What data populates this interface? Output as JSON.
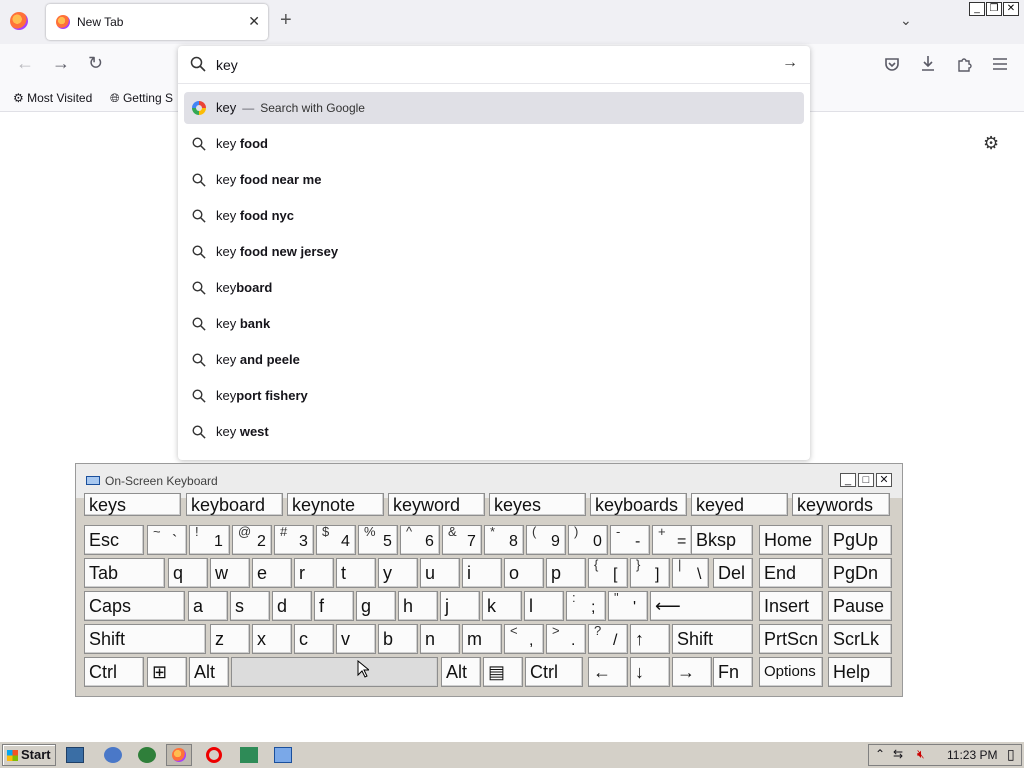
{
  "browser": {
    "tab_title": "New Tab",
    "tab_close": "✕",
    "new_tab_glyph": "+",
    "list_tabs_glyph": "⌄",
    "nav": {
      "back": "←",
      "forward": "→",
      "reload": "↻"
    },
    "bookmarks": [
      {
        "label": "Most Visited",
        "icon": "gear-icon"
      },
      {
        "label": "Getting S",
        "icon": "globe-icon"
      }
    ],
    "window_controls": {
      "minimize": "_",
      "restore": "❐",
      "close": "✕"
    }
  },
  "urlbar": {
    "value": "key",
    "go_glyph": "→",
    "suggestions": [
      {
        "prefix": "key",
        "bold": "",
        "hint": "Search with Google",
        "selected": true,
        "icon": "google-icon"
      },
      {
        "prefix": "key ",
        "bold": "food",
        "icon": "search-icon"
      },
      {
        "prefix": "key ",
        "bold": "food near me",
        "icon": "search-icon"
      },
      {
        "prefix": "key ",
        "bold": "food nyc",
        "icon": "search-icon"
      },
      {
        "prefix": "key ",
        "bold": "food new jersey",
        "icon": "search-icon"
      },
      {
        "prefix": "key",
        "bold": "board",
        "icon": "search-icon"
      },
      {
        "prefix": "key ",
        "bold": "bank",
        "icon": "search-icon"
      },
      {
        "prefix": "key ",
        "bold": "and peele",
        "icon": "search-icon"
      },
      {
        "prefix": "key",
        "bold": "port fishery",
        "icon": "search-icon"
      },
      {
        "prefix": "key ",
        "bold": "west",
        "icon": "search-icon"
      }
    ],
    "separator": "—"
  },
  "osk": {
    "title": "On-Screen Keyboard",
    "controls": {
      "minimize": "_",
      "maximize": "□",
      "close": "✕"
    },
    "predictions": [
      "keys",
      "keyboard",
      "keynote",
      "keyword",
      "keyes",
      "keyboards",
      "keyed",
      "keywords"
    ],
    "rows": [
      [
        {
          "main": "Esc"
        },
        {
          "up": "~",
          "dn": "`"
        },
        {
          "up": "!",
          "dn": "1"
        },
        {
          "up": "@",
          "dn": "2"
        },
        {
          "up": "#",
          "dn": "3"
        },
        {
          "up": "$",
          "dn": "4"
        },
        {
          "up": "%",
          "dn": "5"
        },
        {
          "up": "^",
          "dn": "6"
        },
        {
          "up": "&",
          "dn": "7"
        },
        {
          "up": "*",
          "dn": "8"
        },
        {
          "up": "(",
          "dn": "9"
        },
        {
          "up": ")",
          "dn": "0"
        },
        {
          "up": "-",
          "dn": "-"
        },
        {
          "up": "+",
          "dn": "="
        },
        {
          "main": "Bksp"
        },
        {
          "main": "Home"
        },
        {
          "main": "PgUp"
        }
      ],
      [
        {
          "main": "Tab"
        },
        {
          "main": "q"
        },
        {
          "main": "w"
        },
        {
          "main": "e"
        },
        {
          "main": "r"
        },
        {
          "main": "t"
        },
        {
          "main": "y"
        },
        {
          "main": "u"
        },
        {
          "main": "i"
        },
        {
          "main": "o"
        },
        {
          "main": "p"
        },
        {
          "up": "{",
          "dn": "["
        },
        {
          "up": "}",
          "dn": "]"
        },
        {
          "up": "|",
          "dn": "\\"
        },
        {
          "main": "Del"
        },
        {
          "main": "End"
        },
        {
          "main": "PgDn"
        }
      ],
      [
        {
          "main": "Caps"
        },
        {
          "main": "a"
        },
        {
          "main": "s"
        },
        {
          "main": "d"
        },
        {
          "main": "f"
        },
        {
          "main": "g"
        },
        {
          "main": "h"
        },
        {
          "main": "j"
        },
        {
          "main": "k"
        },
        {
          "main": "l"
        },
        {
          "up": ":",
          "dn": ";"
        },
        {
          "up": "\"",
          "dn": "'"
        },
        {
          "main": "⟵"
        },
        {
          "main": "Insert"
        },
        {
          "main": "Pause"
        }
      ],
      [
        {
          "main": "Shift"
        },
        {
          "main": "z"
        },
        {
          "main": "x"
        },
        {
          "main": "c"
        },
        {
          "main": "v"
        },
        {
          "main": "b"
        },
        {
          "main": "n"
        },
        {
          "main": "m"
        },
        {
          "up": "<",
          "dn": ","
        },
        {
          "up": ">",
          "dn": "."
        },
        {
          "up": "?",
          "dn": "/"
        },
        {
          "main": "↑"
        },
        {
          "main": "Shift"
        },
        {
          "main": "PrtScn"
        },
        {
          "main": "ScrLk"
        }
      ],
      [
        {
          "main": "Ctrl"
        },
        {
          "main": "⊞"
        },
        {
          "main": "Alt"
        },
        {
          "main": ""
        },
        {
          "main": "Alt"
        },
        {
          "main": "▤"
        },
        {
          "main": "Ctrl"
        },
        {
          "main": "←"
        },
        {
          "main": "↓"
        },
        {
          "main": "→"
        },
        {
          "main": "Fn"
        },
        {
          "main": "Options"
        },
        {
          "main": "Help"
        }
      ]
    ]
  },
  "taskbar": {
    "start_label": "Start",
    "clock": "11:23 PM"
  }
}
